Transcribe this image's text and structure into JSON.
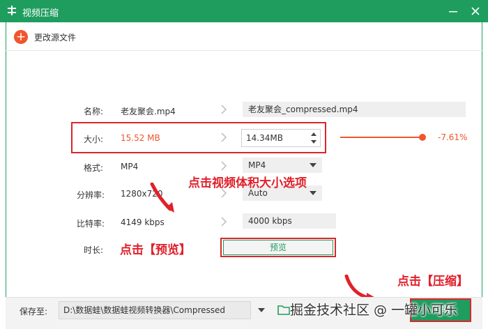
{
  "window": {
    "title": "视频压缩",
    "colors": {
      "accent": "#1f9d5f",
      "highlight": "#f0552c",
      "annotation": "#d9262c"
    }
  },
  "toolbar": {
    "change_source_label": "更改源文件"
  },
  "form": {
    "name": {
      "label": "名称:",
      "source": "老友聚会.mp4",
      "output": "老友聚会_compressed.mp4"
    },
    "size": {
      "label": "大小:",
      "source": "15.52 MB",
      "output": "14.34MB",
      "change_pct": "-7.61%",
      "slider_fraction": 0.92
    },
    "format": {
      "label": "格式:",
      "source": "MP4",
      "output": "MP4"
    },
    "resolution": {
      "label": "分辨率:",
      "source": "1280x720",
      "output": "Auto"
    },
    "bitrate": {
      "label": "比特率:",
      "source": "4149 kbps",
      "output": "4000 kbps"
    },
    "duration": {
      "label": "时长:",
      "preview_label": "预览"
    }
  },
  "bottom": {
    "save_label": "保存至:",
    "path": "D:\\数据蛙\\数据蛙视频转换器\\Compressed",
    "compress_label": "压缩"
  },
  "annotations": {
    "size_hint": "点击视频体积大小选项",
    "preview_hint": "点击【预览】",
    "compress_hint": "点击【压缩】"
  },
  "watermark": "掘金技术社区 @ 一罐小可乐"
}
